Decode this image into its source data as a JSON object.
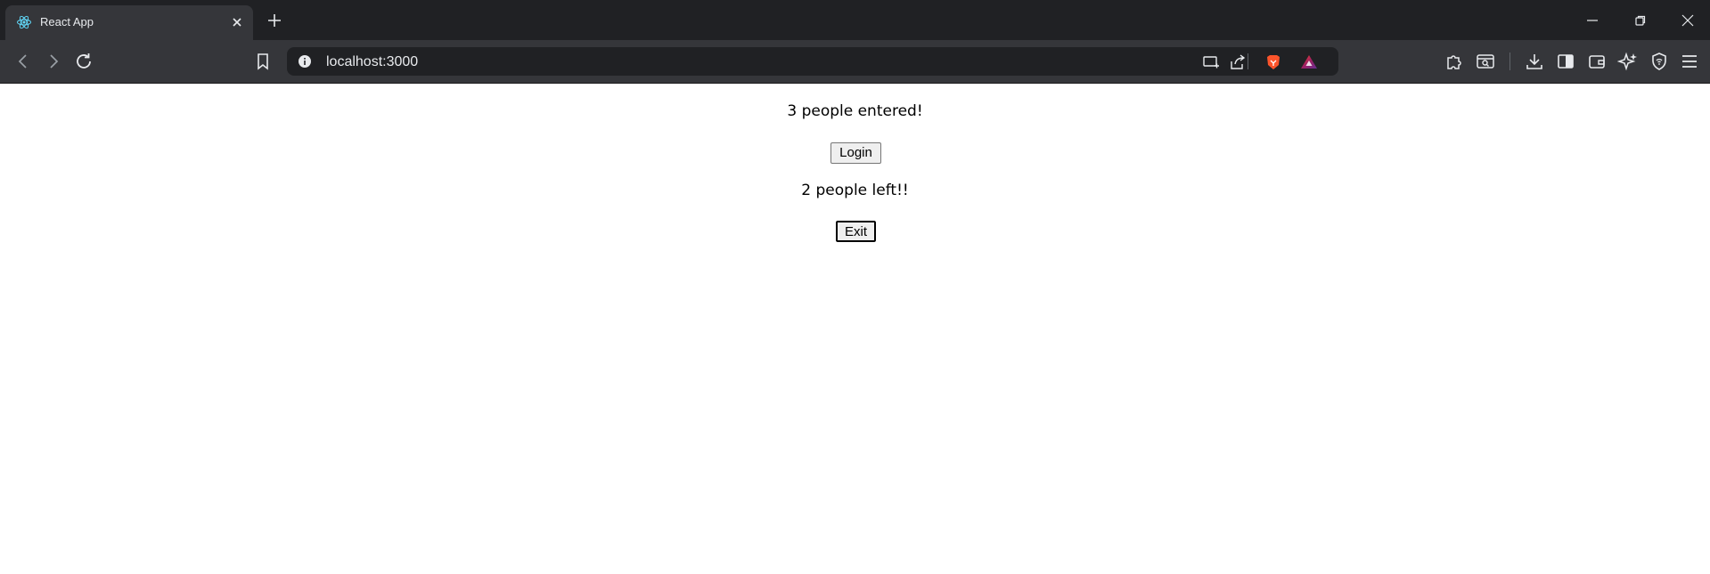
{
  "browser": {
    "tab_title": "React App",
    "url": "localhost:3000",
    "icons": {
      "favicon": "react-logo-icon",
      "tab_close": "close-icon",
      "new_tab": "plus-icon",
      "minimize": "minimize-icon",
      "restore": "restore-icon",
      "close": "close-icon",
      "back": "back-arrow-icon",
      "forward": "forward-arrow-icon",
      "reload": "reload-icon",
      "bookmark": "bookmark-icon",
      "site_info": "info-icon",
      "cast": "cast-icon",
      "share": "share-icon",
      "brave_shields": "brave-lion-icon",
      "brave_rewards": "brave-rewards-icon",
      "extensions": "puzzle-icon",
      "tab_search": "tab-search-icon",
      "downloads": "download-icon",
      "sidebar": "sidebar-icon",
      "wallet": "wallet-icon",
      "leo": "leo-ai-icon",
      "vpn": "vpn-shield-icon",
      "menu": "hamburger-menu-icon"
    },
    "colors": {
      "frame": "#202124",
      "toolbar": "#35363a",
      "react": "#61dafb",
      "brave": "#fb542b"
    }
  },
  "page": {
    "entered_message": "3 people entered!",
    "login_label": "Login",
    "left_message": "2 people left!!",
    "exit_label": "Exit"
  }
}
